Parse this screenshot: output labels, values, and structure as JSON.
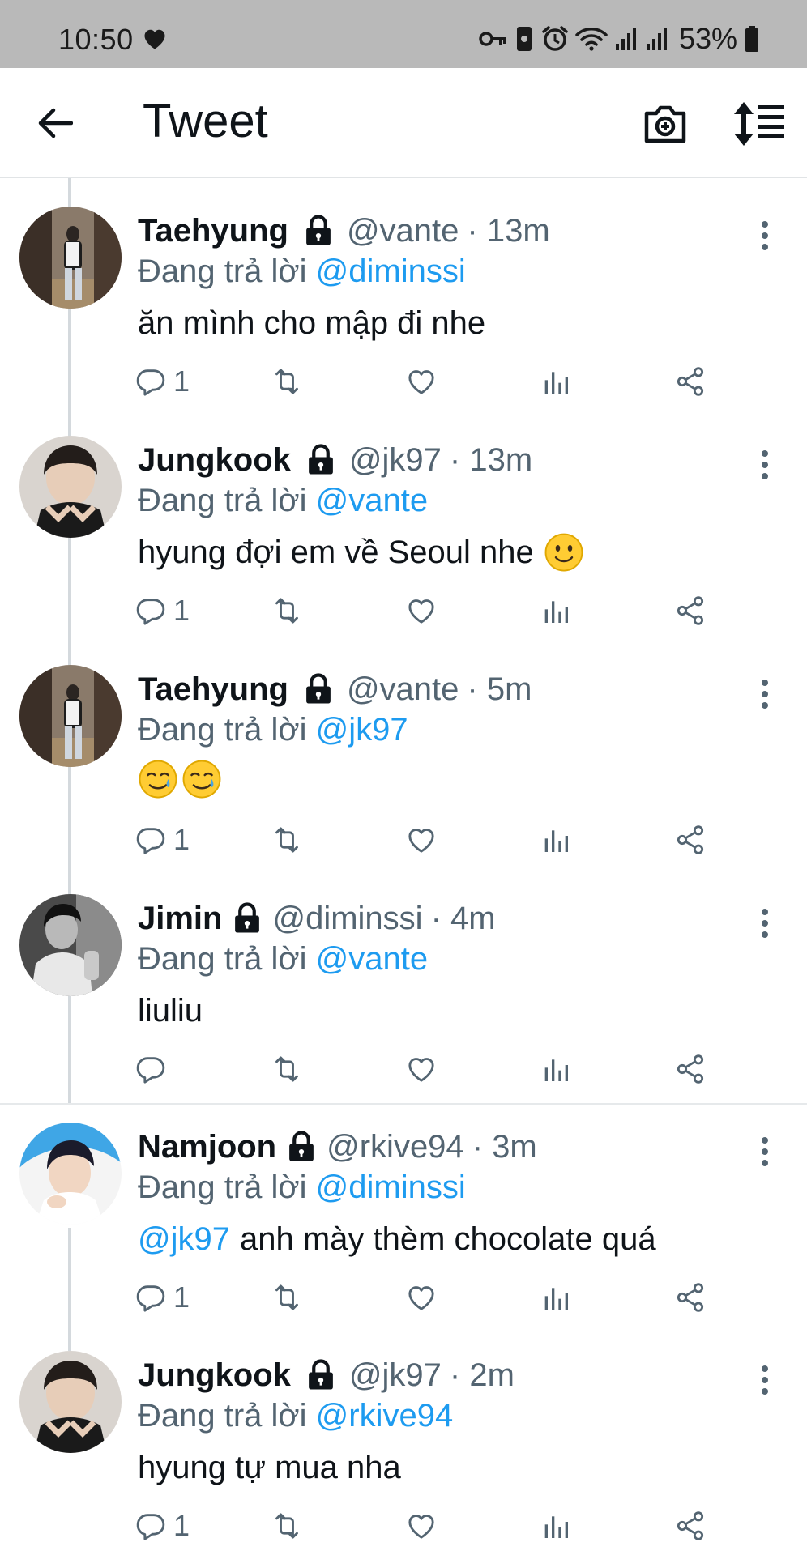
{
  "status_bar": {
    "time": "10:50",
    "battery": "53%"
  },
  "header": {
    "title": "Tweet"
  },
  "colors": {
    "accent": "#1d9bf0",
    "muted": "#536471",
    "text": "#0f1419"
  },
  "icons": [
    "heart-icon",
    "key-icon",
    "lock-icon",
    "alarm-icon",
    "wifi-icon",
    "signal-icon",
    "battery-icon",
    "back-arrow-icon",
    "camera-icon",
    "sort-icon",
    "more-icon",
    "reply-icon",
    "retweet-icon",
    "like-icon",
    "views-icon",
    "share-icon"
  ],
  "tweets": [
    {
      "name": "Taehyung",
      "handle": "@vante",
      "time": "· 13m",
      "reply_prefix": "Đang trả lời",
      "reply_to": "@diminssi",
      "mention": "",
      "text": "ăn mình cho mập đi nhe",
      "emoji": "",
      "reply_count": "1"
    },
    {
      "name": "Jungkook",
      "handle": "@jk97",
      "time": "· 13m",
      "reply_prefix": "Đang trả lời",
      "reply_to": "@vante",
      "mention": "",
      "text": "hyung đợi em về Seoul nhe",
      "emoji": "slightly-smiling-face",
      "reply_count": "1"
    },
    {
      "name": "Taehyung",
      "handle": "@vante",
      "time": "· 5m",
      "reply_prefix": "Đang trả lời",
      "reply_to": "@jk97",
      "mention": "",
      "text": "",
      "emoji": "smiling-face-with-tear-x2",
      "reply_count": "1"
    },
    {
      "name": "Jimin",
      "handle": "@diminssi",
      "time": "· 4m",
      "reply_prefix": "Đang trả lời",
      "reply_to": "@vante",
      "mention": "",
      "text": "liuliu",
      "emoji": "",
      "reply_count": ""
    },
    {
      "name": "Namjoon",
      "handle": "@rkive94",
      "time": "· 3m",
      "reply_prefix": "Đang trả lời",
      "reply_to": "@diminssi",
      "mention": "@jk97",
      "text": "anh mày thèm chocolate quá",
      "emoji": "",
      "reply_count": "1"
    },
    {
      "name": "Jungkook",
      "handle": "@jk97",
      "time": "· 2m",
      "reply_prefix": "Đang trả lời",
      "reply_to": "@rkive94",
      "mention": "",
      "text": "hyung tự mua nha",
      "emoji": "",
      "reply_count": "1"
    }
  ]
}
